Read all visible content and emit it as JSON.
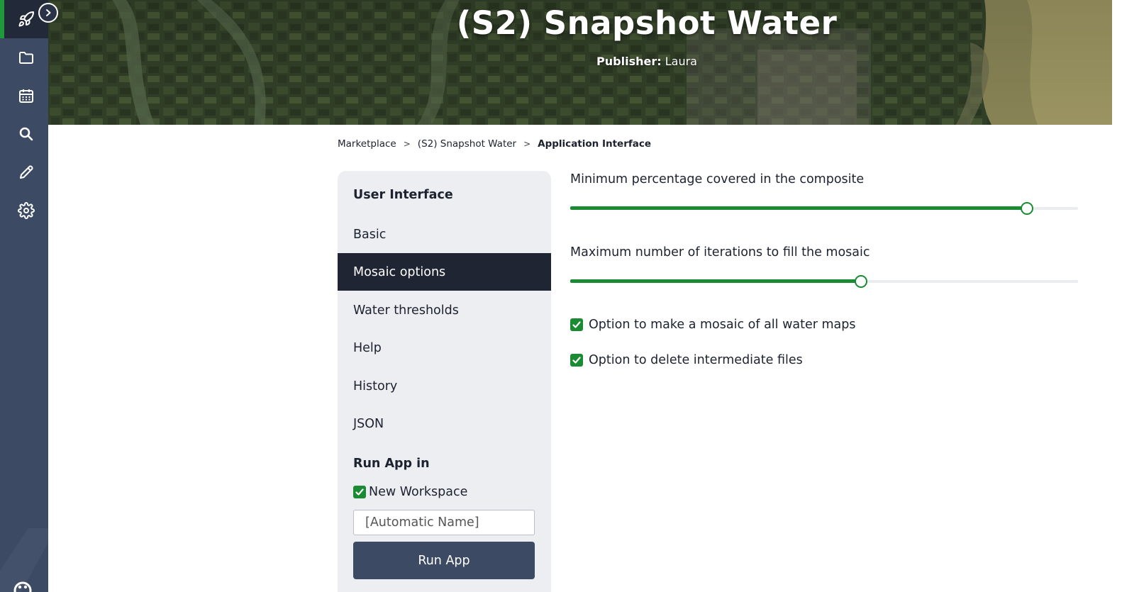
{
  "app": {
    "title": "(S2) Snapshot Water",
    "publisher_label": "Publisher:",
    "publisher_name": "Laura"
  },
  "rail": {
    "items": [
      {
        "icon": "rocket-icon",
        "active": true
      },
      {
        "icon": "folder-icon",
        "active": false
      },
      {
        "icon": "calendar-icon",
        "active": false
      },
      {
        "icon": "search-icon",
        "active": false
      },
      {
        "icon": "pencil-icon",
        "active": false
      },
      {
        "icon": "gear-icon",
        "active": false
      }
    ],
    "expand_icon": "chevron-right-circle-icon",
    "accent_color": "#1e9a3c",
    "background_color": "#3d4a63"
  },
  "breadcrumb": {
    "items": [
      "Marketplace",
      "(S2) Snapshot Water",
      "Application Interface"
    ],
    "separator": ">"
  },
  "menu": {
    "heading": "User Interface",
    "items": [
      {
        "label": "Basic",
        "active": false
      },
      {
        "label": "Mosaic options",
        "active": true
      },
      {
        "label": "Water thresholds",
        "active": false
      },
      {
        "label": "Help",
        "active": false
      },
      {
        "label": "History",
        "active": false
      },
      {
        "label": "JSON",
        "active": false
      }
    ],
    "run_heading": "Run App in",
    "new_workspace_label": "New Workspace",
    "new_workspace_checked": true,
    "workspace_name_placeholder": "[Automatic Name]",
    "run_button": "Run App"
  },
  "options": {
    "min_percentage": {
      "label": "Minimum percentage covered in the composite",
      "fill_fraction": 0.9
    },
    "max_iterations": {
      "label": "Maximum number of iterations to fill the mosaic",
      "fill_fraction": 0.572
    },
    "mosaic_all": {
      "label": "Option to make a mosaic of all water maps",
      "checked": true
    },
    "delete_intermediate": {
      "label": "Option to delete intermediate files",
      "checked": true
    },
    "accent_color": "#1a8a33"
  }
}
